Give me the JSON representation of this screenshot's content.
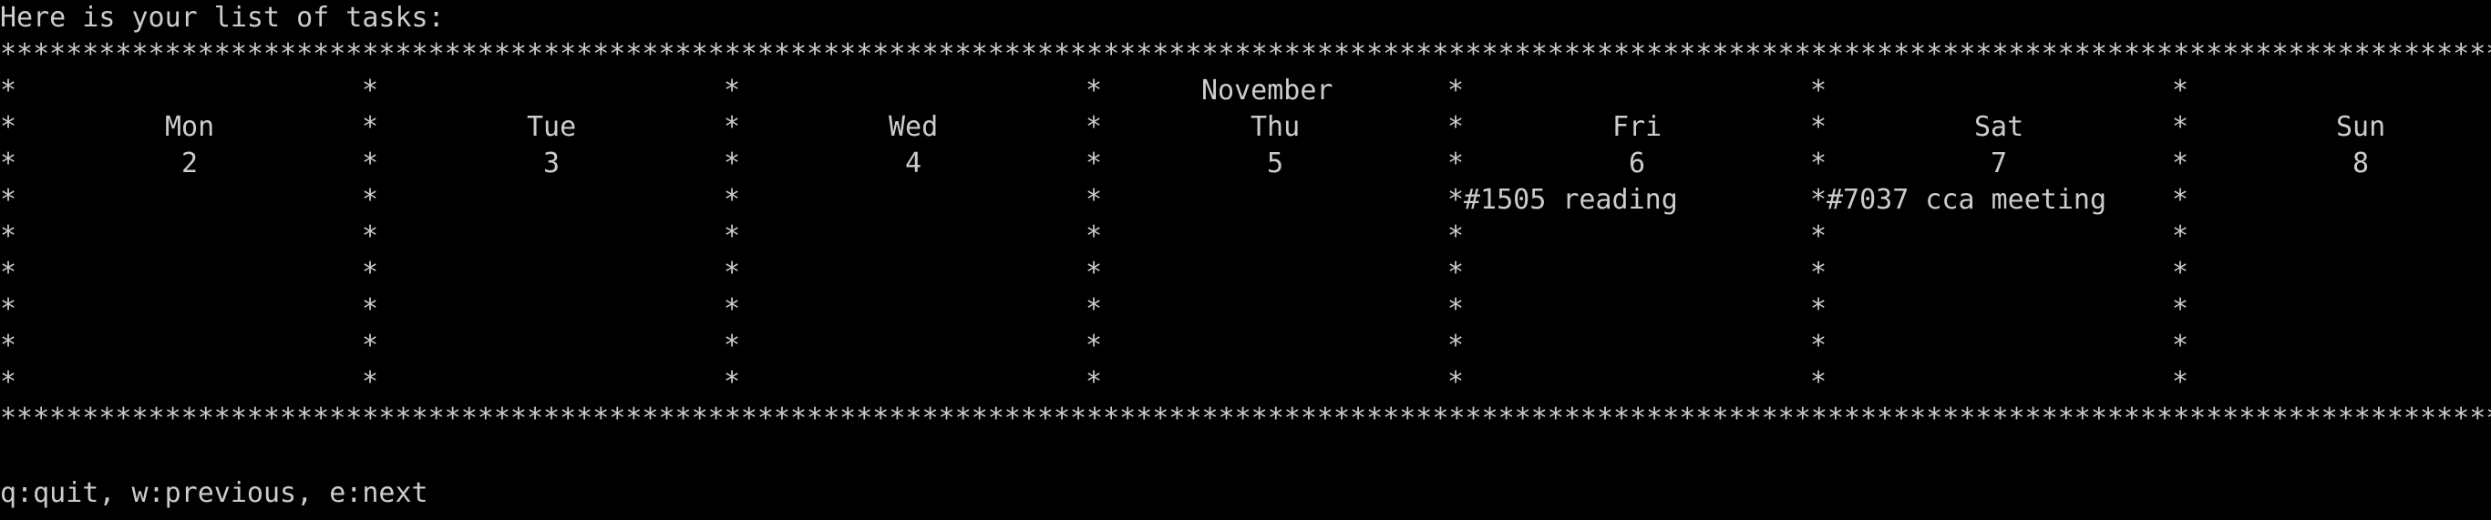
{
  "terminal": {
    "header_text": "Here is your list of tasks:",
    "border_char": "*",
    "month": "November",
    "days": [
      {
        "name": "Mon",
        "date": "2",
        "tasks": []
      },
      {
        "name": "Tue",
        "date": "3",
        "tasks": []
      },
      {
        "name": "Wed",
        "date": "4",
        "tasks": []
      },
      {
        "name": "Thu",
        "date": "5",
        "tasks": []
      },
      {
        "name": "Fri",
        "date": "6",
        "tasks": [
          "#1505 reading"
        ]
      },
      {
        "name": "Sat",
        "date": "7",
        "tasks": [
          "#7037 cca meeting"
        ]
      },
      {
        "name": "Sun",
        "date": "8",
        "tasks": []
      }
    ],
    "footer_text": "q:quit, w:previous, e:next",
    "colors": {
      "background": "#000000",
      "text": "#cccccc"
    }
  }
}
